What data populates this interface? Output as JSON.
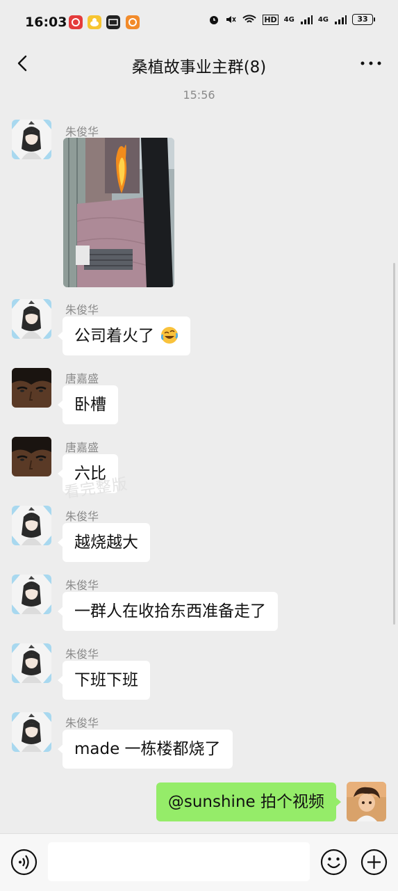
{
  "status_bar": {
    "time": "16:03",
    "network_label_1": "4G",
    "network_label_2": "4G",
    "battery": "33",
    "app_icons": [
      "netease-music-icon",
      "duck-app-icon",
      "iqiyi-icon",
      "orange-app-icon"
    ],
    "status_icons": [
      "alarm-icon",
      "mute-icon",
      "wifi-icon",
      "hd-icon",
      "signal-icon",
      "signal-icon"
    ]
  },
  "nav": {
    "title": "桑植故事业主群(8)",
    "back_icon": "chevron-left-icon",
    "more_icon": "more-dots-icon"
  },
  "chat": {
    "timestamp": "15:56",
    "watermark": "看完整版",
    "messages": [
      {
        "sender": "朱俊华",
        "type": "image",
        "image_desc": "building-on-fire-photo"
      },
      {
        "sender": "朱俊华",
        "text": "公司着火了",
        "emoji": "rolling-laugh-emoji"
      },
      {
        "sender": "唐嘉盛",
        "text": "卧槽"
      },
      {
        "sender": "唐嘉盛",
        "text": "六比"
      },
      {
        "sender": "朱俊华",
        "text": "越烧越大"
      },
      {
        "sender": "朱俊华",
        "text": "一群人在收拾东西准备走了"
      },
      {
        "sender": "朱俊华",
        "text": "下班下班"
      },
      {
        "sender": "朱俊华",
        "text": "made 一栋楼都烧了"
      },
      {
        "sender": "",
        "text": "@sunshine  拍个视频",
        "mine": true
      }
    ]
  },
  "input_bar": {
    "voice_icon": "voice-icon",
    "emoji_icon": "emoji-icon",
    "plus_icon": "plus-icon",
    "text_value": ""
  },
  "colors": {
    "background": "#ededed",
    "bubble_other": "#ffffff",
    "bubble_mine": "#95ec69",
    "meta_text": "#8a8a8a"
  }
}
